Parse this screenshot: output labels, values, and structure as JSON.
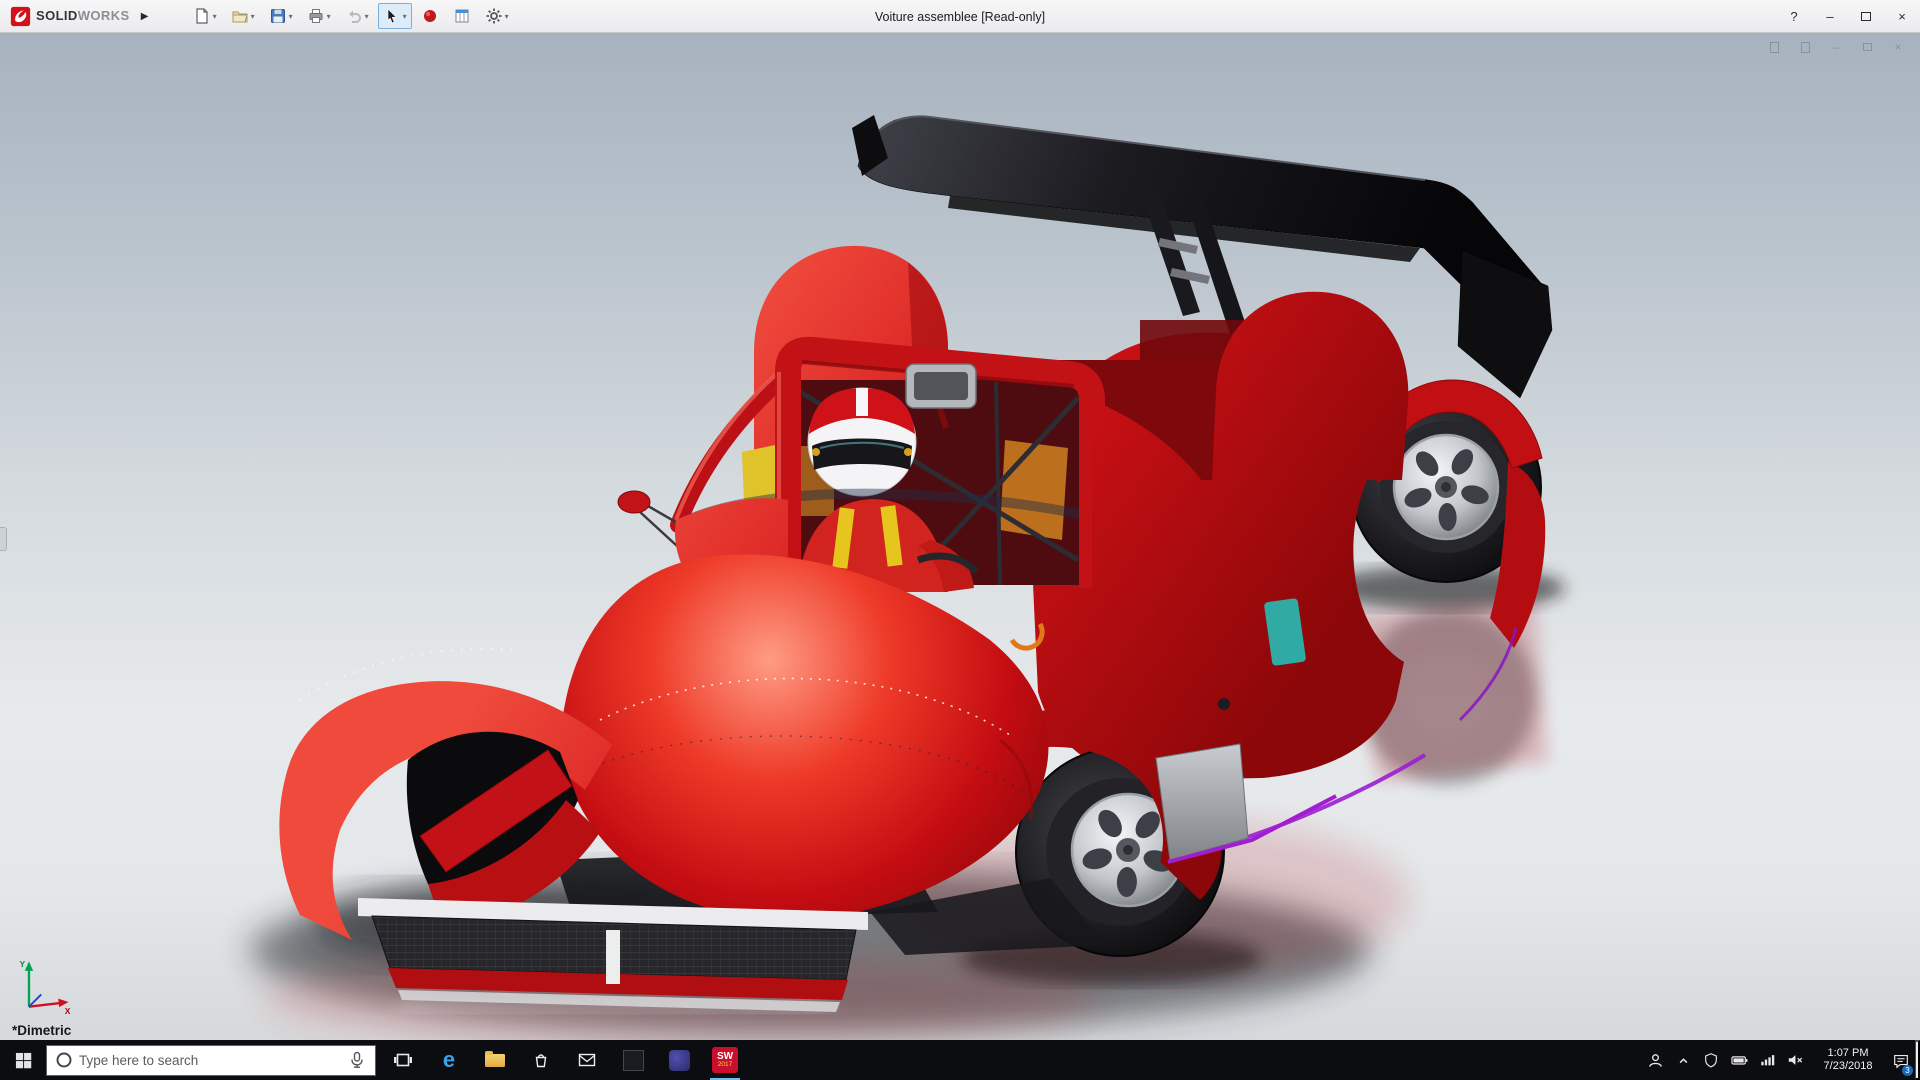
{
  "window": {
    "brand": {
      "solid": "SOLID",
      "works": "WORKS"
    },
    "expand_arrow": "▶",
    "title": "Voiture assemblee [Read-only]",
    "controls": {
      "help": "?",
      "minimize": "–",
      "close": "×"
    }
  },
  "toolbar": {
    "caret": "▾",
    "items": [
      {
        "name": "new-document",
        "enabled": true
      },
      {
        "name": "open",
        "enabled": true
      },
      {
        "name": "save",
        "enabled": true
      },
      {
        "name": "print",
        "enabled": true
      },
      {
        "name": "undo",
        "enabled": false
      },
      {
        "name": "select",
        "enabled": true,
        "active": true
      },
      {
        "name": "appearance",
        "enabled": true
      },
      {
        "name": "design-library",
        "enabled": true
      },
      {
        "name": "options",
        "enabled": true
      }
    ]
  },
  "document_controls": {
    "minimize": "–",
    "close": "×"
  },
  "viewport": {
    "view_label": "*Dimetric",
    "triad": {
      "x": "X",
      "y": "Y"
    }
  },
  "taskbar": {
    "search": {
      "placeholder": "Type here to search"
    },
    "edge_glyph": "e",
    "sw_badge": {
      "top": "SW",
      "bottom": "2017"
    },
    "clock": {
      "time": "1:07 PM",
      "date": "7/23/2018"
    },
    "notification_badge": "3"
  },
  "palette": {
    "car_red": "#c8102e",
    "taskbar_bg": "#0b0d11",
    "titlebar_bg": "#f2f2f4",
    "selection_blue": "#7ab0e0",
    "teal_accent": "#1fc0ba",
    "purple_accent": "#a01ed0"
  }
}
